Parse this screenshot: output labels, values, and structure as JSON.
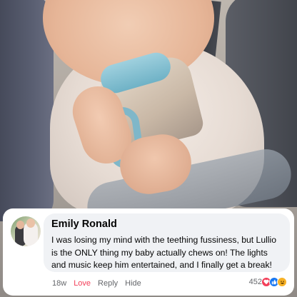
{
  "comment": {
    "author": "Emily Ronald",
    "text": "I was losing my mind with the teething fussiness, but Lullio is the ONLY thing my baby actually chews on! The lights and music keep him entertained, and I finally get a break!",
    "time": "18w",
    "love_label": "Love",
    "reply_label": "Reply",
    "hide_label": "Hide",
    "reaction_count": "452",
    "reaction_icons": [
      "heart-icon",
      "like-icon",
      "laugh-icon"
    ]
  },
  "colors": {
    "love": "#f33e58",
    "like": "#1877f2",
    "laugh": "#f7b125",
    "bubble": "#f0f2f5",
    "muted_text": "#65676b"
  }
}
